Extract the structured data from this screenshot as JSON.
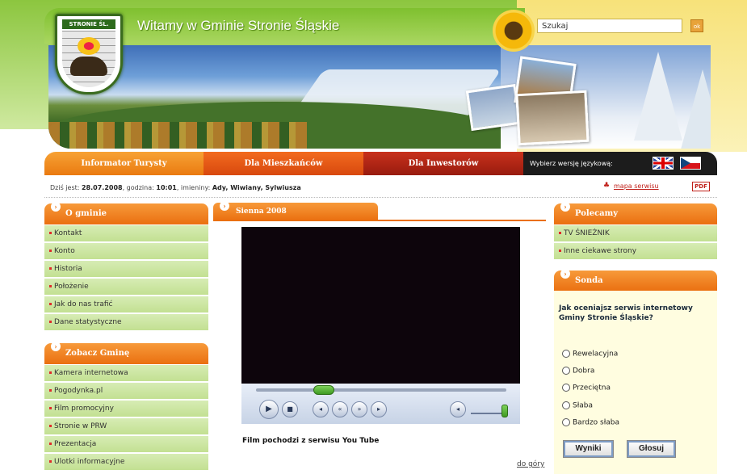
{
  "header": {
    "welcome": "Witamy w Gminie Stronie Śląskie",
    "logo_text": "STRONIE ŚL.",
    "search_placeholder": "Szukaj",
    "search_button": "ok"
  },
  "nav": {
    "items": [
      {
        "label": "Informator Turysty"
      },
      {
        "label": "Dla Mieszkańców"
      },
      {
        "label": "Dla Inwestorów"
      }
    ],
    "language_label": "Wybierz wersję językową:"
  },
  "dateline": {
    "prefix": "Dziś jest:",
    "date": "28.07.2008",
    "time_label": ", godzina:",
    "time": "10:01",
    "names_label": ", imieniny:",
    "names": "Ady, Wiwiany, Sylwiusza",
    "sitemap": "mapa serwisu",
    "pdf": "PDF"
  },
  "left": {
    "o_gminie_title": "O gminie",
    "o_gminie_items": [
      "Kontakt",
      "Konto",
      "Historia",
      "Położenie",
      "Jak do nas trafić",
      "Dane statystyczne"
    ],
    "zobacz_title": "Zobacz Gminę",
    "zobacz_items": [
      "Kamera internetowa",
      "Pogodynka.pl",
      "Film promocyjny",
      "Stronie w PRW",
      "Prezentacja",
      "Ulotki informacyjne"
    ]
  },
  "main": {
    "tab_title": "Sienna 2008",
    "source_text": "Film pochodzi z serwisu You Tube",
    "to_top": "do góry",
    "seek_fraction": 0.25
  },
  "right": {
    "polecamy_title": "Polecamy",
    "polecamy_items": [
      "TV ŚNIEŻNIK",
      "Inne ciekawe strony"
    ],
    "sonda_title": "Sonda",
    "question": "Jak oceniajsz serwis internetowy Gminy Stronie Śląskie?",
    "options": [
      "Rewelacyjna",
      "Dobra",
      "Przeciętna",
      "Słaba",
      "Bardzo słaba"
    ],
    "results_button": "Wyniki",
    "vote_button": "Głosuj"
  }
}
